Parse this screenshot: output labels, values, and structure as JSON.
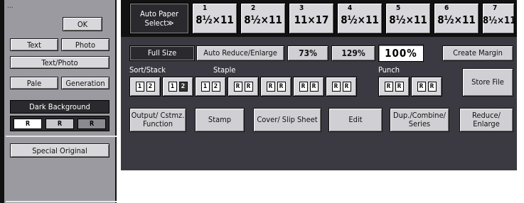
{
  "left_panel": {
    "top_partial": "...",
    "ok": "OK",
    "text": "Text",
    "photo": "Photo",
    "text_photo": "Text/Photo",
    "pale": "Pale",
    "generation": "Generation",
    "dark_background": "Dark Background",
    "density": [
      "R",
      "R",
      "R"
    ],
    "special_original": "Special Original"
  },
  "paper_select": {
    "auto_label": "Auto Paper Select≫",
    "trays": [
      {
        "tray": "1",
        "size": "8½×11"
      },
      {
        "tray": "2",
        "size": "8½×11"
      },
      {
        "tray": "3",
        "size": "11×17"
      },
      {
        "tray": "4",
        "size": "8½×11"
      },
      {
        "tray": "5",
        "size": "8½×11"
      },
      {
        "tray": "6",
        "size": "8½×11"
      },
      {
        "tray": "7",
        "size": "8½×11"
      }
    ]
  },
  "reduce": {
    "full_size": "Full Size",
    "auto_reduce": "Auto Reduce/Enlarge",
    "preset1": "73%",
    "preset2": "129%",
    "ratio": "100%",
    "create_margin": "Create Margin"
  },
  "finishing": {
    "sort_stack_label": "Sort/Stack",
    "staple_label": "Staple",
    "punch_label": "Punch",
    "store_file": "Store File"
  },
  "functions": {
    "output": "Output/ Cstmz. Function",
    "stamp": "Stamp",
    "cover": "Cover/ Slip Sheet",
    "edit": "Edit",
    "dup": "Dup./Combine/ Series",
    "reduce_enlarge": "Reduce/ Enlarge"
  }
}
